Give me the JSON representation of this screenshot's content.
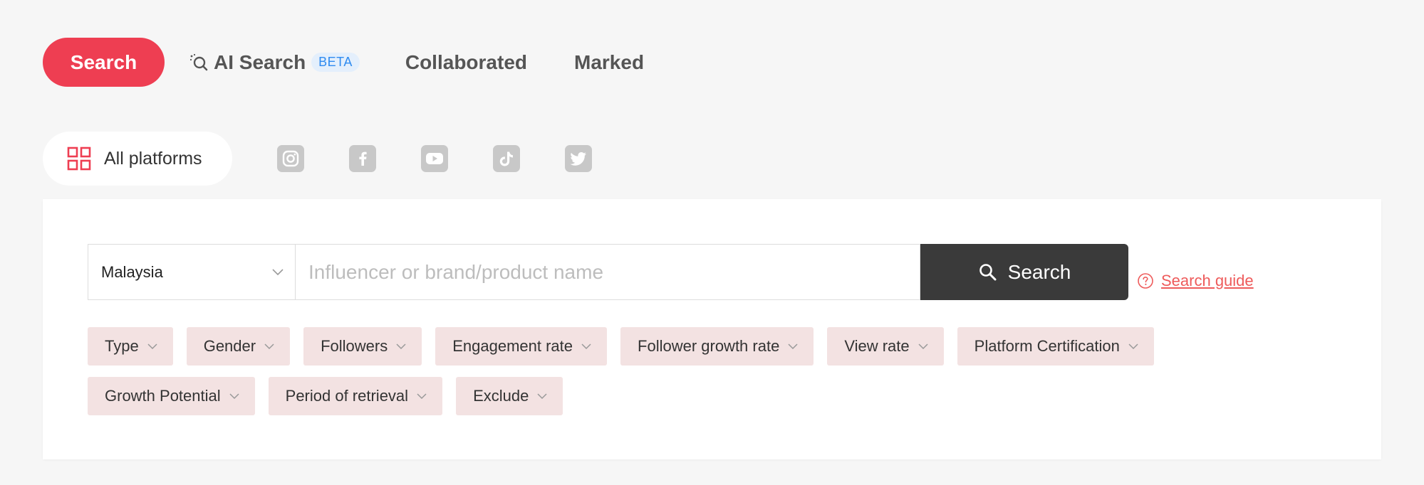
{
  "tabs": {
    "search": "Search",
    "ai_search": "AI Search",
    "beta": "BETA",
    "collaborated": "Collaborated",
    "marked": "Marked"
  },
  "platforms": {
    "all": "All platforms",
    "icons": [
      "instagram-icon",
      "facebook-icon",
      "youtube-icon",
      "tiktok-icon",
      "twitter-icon"
    ]
  },
  "search": {
    "country": "Malaysia",
    "placeholder": "Influencer or brand/product name",
    "query": "",
    "button": "Search",
    "guide": "Search guide"
  },
  "filters": {
    "row1": [
      "Type",
      "Gender",
      "Followers",
      "Engagement rate",
      "Follower growth rate",
      "View rate",
      "Platform Certification"
    ],
    "row2": [
      "Growth Potential",
      "Period of retrieval",
      "Exclude"
    ]
  },
  "colors": {
    "accent": "#ee3e52",
    "beta_bg": "#e4effc",
    "beta_text": "#2f8bf0",
    "search_button": "#3a3a3a",
    "chip_bg": "#f3e2e2",
    "guide_link": "#ee5b5b"
  }
}
